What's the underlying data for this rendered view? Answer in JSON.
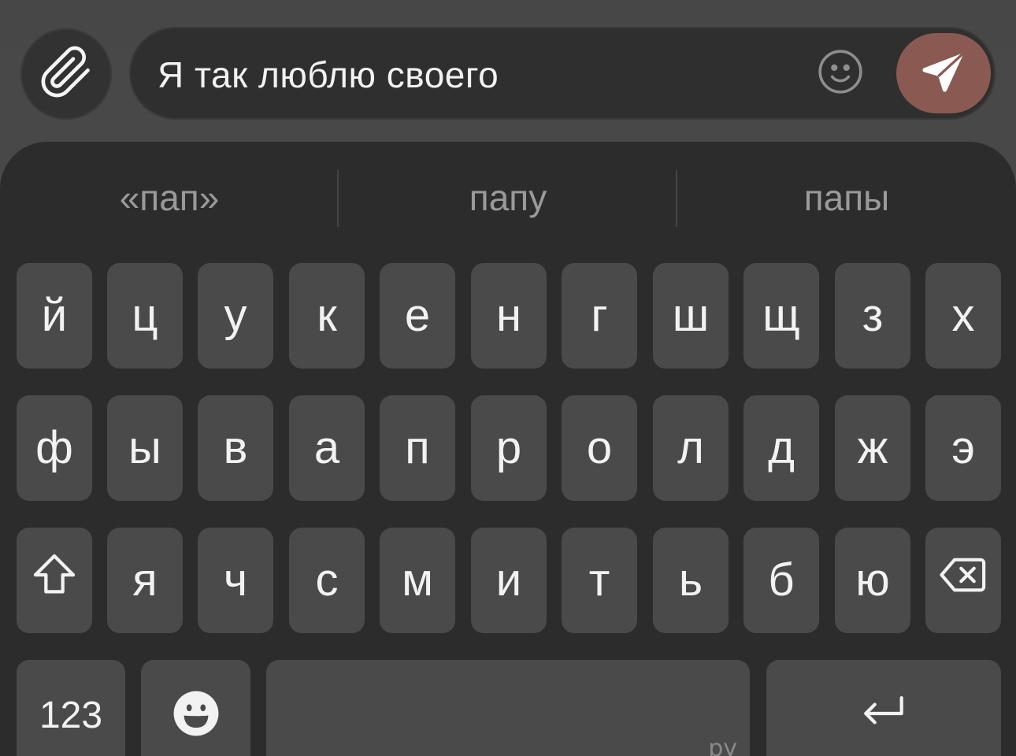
{
  "compose": {
    "text": "Я так люблю своего"
  },
  "colors": {
    "send_accent": "#8a5a52",
    "keyboard_bg": "#2c2c2c",
    "key_bg": "#4a4a4a"
  },
  "suggestions": [
    "«пап»",
    "папу",
    "папы"
  ],
  "rows": [
    [
      "й",
      "ц",
      "у",
      "к",
      "е",
      "н",
      "г",
      "ш",
      "щ",
      "з",
      "х"
    ],
    [
      "ф",
      "ы",
      "в",
      "а",
      "п",
      "р",
      "о",
      "л",
      "д",
      "ж",
      "э"
    ],
    [
      "я",
      "ч",
      "с",
      "м",
      "и",
      "т",
      "ь",
      "б",
      "ю"
    ]
  ],
  "bottom_row": {
    "numbers_label": "123",
    "space_lang": "ру"
  },
  "icons": {
    "attach": "paperclip-icon",
    "emoji": "smiley-icon",
    "send": "paper-plane-icon",
    "shift": "shift-arrow-icon",
    "backspace": "backspace-icon",
    "emoji_key": "emoji-face-icon",
    "return": "return-arrow-icon"
  }
}
